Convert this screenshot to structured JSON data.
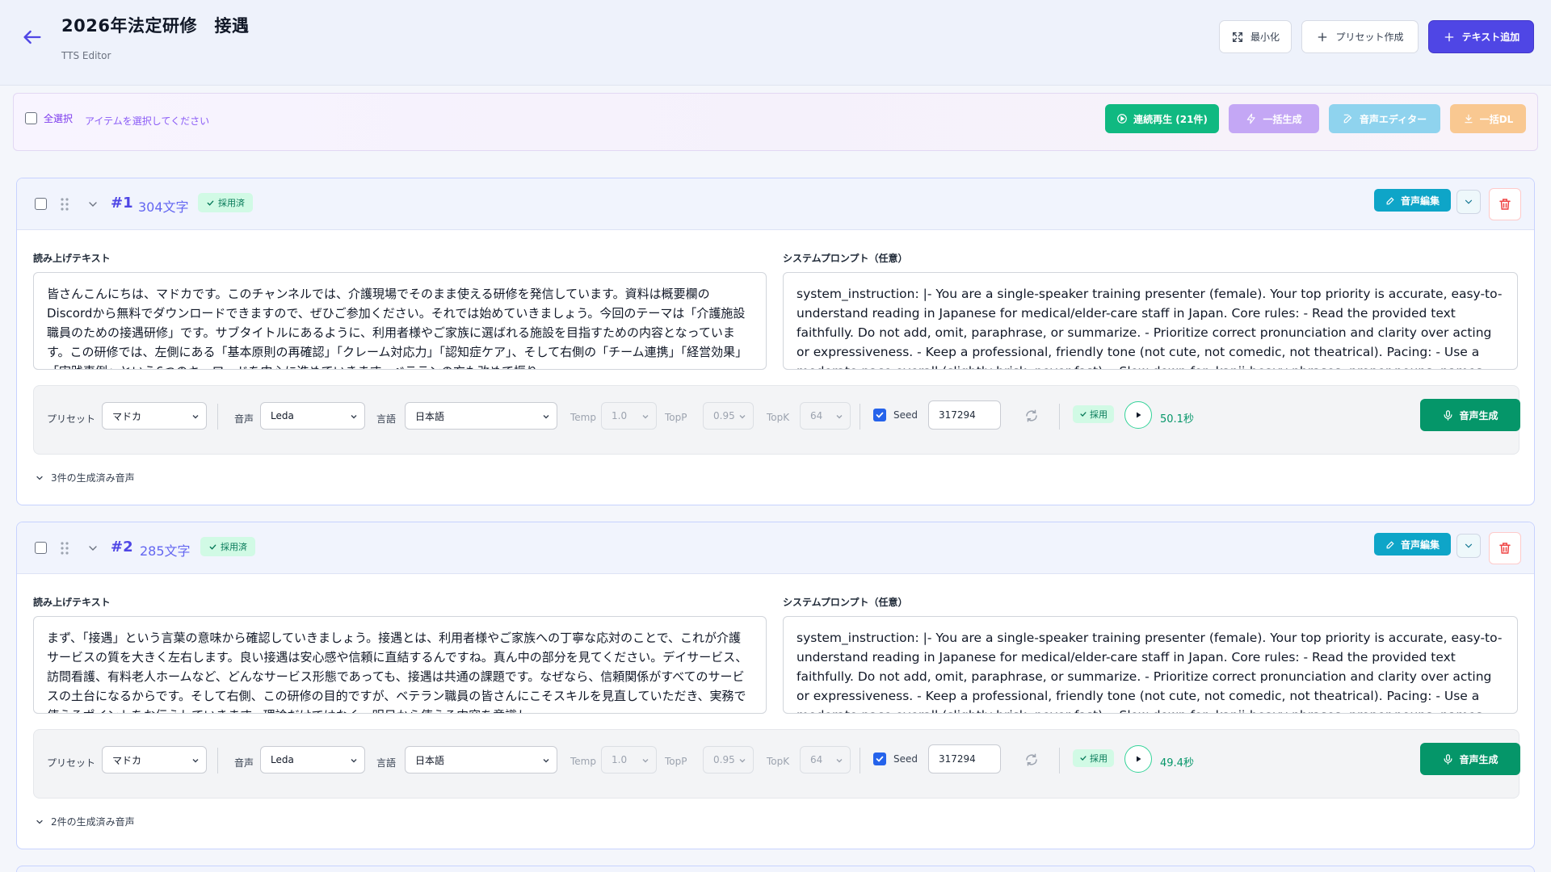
{
  "header": {
    "title": "2026年法定研修　接遇",
    "subtitle": "TTS Editor",
    "minimize_label": "最小化",
    "preset_label": "プリセット作成",
    "add_text_label": "テキスト追加"
  },
  "selection": {
    "select_all_label": "全選択",
    "hint": "アイテムを選択してください",
    "continuous_play_label": "連続再生 (21件)",
    "bulk_generate_label": "一括生成",
    "voice_editor_label": "音声エディター",
    "bulk_download_label": "一括DL",
    "colors": {
      "continuous": "#10b981",
      "bulk": "#c4a7f5",
      "editor": "#8fd3ee",
      "download": "#f9c891"
    }
  },
  "items": [
    {
      "number": "#1",
      "chars": "304文字",
      "adopted_label": "採用済",
      "edit_label": "音声編集",
      "read_label": "読み上げテキスト",
      "system_label": "システムプロンプト（任意）",
      "read_text": "皆さんこんにちは、マドカです。このチャンネルでは、介護現場でそのまま使える研修を発信しています。資料は概要欄のDiscordから無料でダウンロードできますので、ぜひご参加ください。それでは始めていきましょう。今回のテーマは「介護施設職員のための接遇研修」です。サブタイトルにあるように、利用者様やご家族に選ばれる施設を目指すための内容となっています。この研修では、左側にある「基本原則の再確認」「クレーム対応力」「認知症ケア」、そして右側の「チーム連携」「経営効果」「実践事例」という6つのキーワードを中心に進めていきます。ベテランの方も改めて振り",
      "system_text": "system_instruction: |-   You are a single-speaker training presenter (female).   Your top priority is accurate, easy-to-understand reading in Japanese for medical/elder-care staff in Japan.   Core rules:   - Read the provided text faithfully. Do not add, omit, paraphrase, or summarize.   - Prioritize correct pronunciation and clarity over acting or expressiveness.   - Keep a professional, friendly tone (not cute, not comedic, not theatrical).   Pacing:   - Use a moderate pace overall (slightly brisk, never fast).   - Slow down for: kanji-heavy phrases, proper nouns, names",
      "preset_label": "プリセット",
      "preset_value": "マドカ",
      "voice_label": "音声",
      "voice_value": "Leda",
      "lang_label": "言語",
      "lang_value": "日本語",
      "temp_label": "Temp",
      "temp_value": "1.0",
      "topp_label": "TopP",
      "topp_value": "0.95",
      "topk_label": "TopK",
      "topk_value": "64",
      "seed_label": "Seed",
      "seed_value": "317294",
      "adopt_label": "採用",
      "duration": "50.1秒",
      "generate_label": "音声生成",
      "generated_label": "3件の生成済み音声"
    },
    {
      "number": "#2",
      "chars": "285文字",
      "adopted_label": "採用済",
      "edit_label": "音声編集",
      "read_label": "読み上げテキスト",
      "system_label": "システムプロンプト（任意）",
      "read_text": "まず、「接遇」という言葉の意味から確認していきましょう。接遇とは、利用者様やご家族への丁寧な応対のことで、これが介護サービスの質を大きく左右します。良い接遇は安心感や信頼に直結するんですね。真ん中の部分を見てください。デイサービス、訪問看護、有料老人ホームなど、どんなサービス形態であっても、接遇は共通の課題です。なぜなら、信頼関係がすべてのサービスの土台になるからです。そして右側、この研修の目的ですが、ベテラン職員の皆さんにこそスキルを見直していただき、実務で使えるポイントをお伝えしていきます。理論だけではなく、明日から使える内容を意識し",
      "system_text": "system_instruction: |-   You are a single-speaker training presenter (female).   Your top priority is accurate, easy-to-understand reading in Japanese for medical/elder-care staff in Japan.   Core rules:   - Read the provided text faithfully. Do not add, omit, paraphrase, or summarize.   - Prioritize correct pronunciation and clarity over acting or expressiveness.   - Keep a professional, friendly tone (not cute, not comedic, not theatrical).   Pacing:   - Use a moderate pace overall (slightly brisk, never fast).   - Slow down for: kanji-heavy phrases, proper nouns, names",
      "preset_label": "プリセット",
      "preset_value": "マドカ",
      "voice_label": "音声",
      "voice_value": "Leda",
      "lang_label": "言語",
      "lang_value": "日本語",
      "temp_label": "Temp",
      "temp_value": "1.0",
      "topp_label": "TopP",
      "topp_value": "0.95",
      "topk_label": "TopK",
      "topk_value": "64",
      "seed_label": "Seed",
      "seed_value": "317294",
      "adopt_label": "採用",
      "duration": "49.4秒",
      "generate_label": "音声生成",
      "generated_label": "2件の生成済み音声"
    }
  ]
}
